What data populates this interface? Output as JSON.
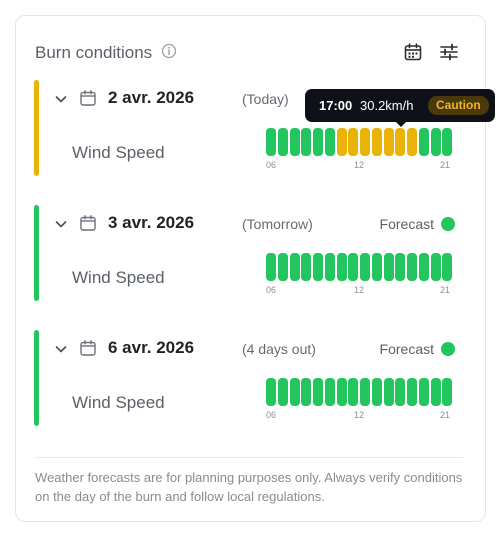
{
  "header": {
    "title": "Burn conditions",
    "icons": [
      "info-icon",
      "calendar-icon",
      "sliders-icon"
    ]
  },
  "colors": {
    "green": "#22c55e",
    "yellow": "#eab308",
    "caution_bg": "#4a3a0b",
    "caution_text": "#f0b429"
  },
  "days": [
    {
      "date": "2 avr. 2026",
      "relative": "(Today)",
      "status": "",
      "metric": "Wind Speed",
      "bar_color": "#eab308",
      "hours": [
        "green",
        "green",
        "green",
        "green",
        "green",
        "green",
        "yellow",
        "yellow",
        "yellow",
        "yellow",
        "yellow",
        "yellow",
        "yellow",
        "green",
        "green",
        "green"
      ],
      "ticks": [
        "06",
        "12",
        "21"
      ]
    },
    {
      "date": "3 avr. 2026",
      "relative": "(Tomorrow)",
      "status": "Forecast",
      "metric": "Wind Speed",
      "bar_color": "#22c55e",
      "hours": [
        "green",
        "green",
        "green",
        "green",
        "green",
        "green",
        "green",
        "green",
        "green",
        "green",
        "green",
        "green",
        "green",
        "green",
        "green",
        "green"
      ],
      "ticks": [
        "06",
        "12",
        "21"
      ]
    },
    {
      "date": "6 avr. 2026",
      "relative": "(4 days out)",
      "status": "Forecast",
      "metric": "Wind Speed",
      "bar_color": "#22c55e",
      "hours": [
        "green",
        "green",
        "green",
        "green",
        "green",
        "green",
        "green",
        "green",
        "green",
        "green",
        "green",
        "green",
        "green",
        "green",
        "green",
        "green"
      ],
      "ticks": [
        "06",
        "12",
        "21"
      ]
    }
  ],
  "tooltip": {
    "time": "17:00",
    "value": "30.2km/h",
    "badge": "Caution"
  },
  "footer": {
    "note": "Weather forecasts are for planning purposes only. Always verify conditions on the day of the burn and follow local regulations."
  }
}
